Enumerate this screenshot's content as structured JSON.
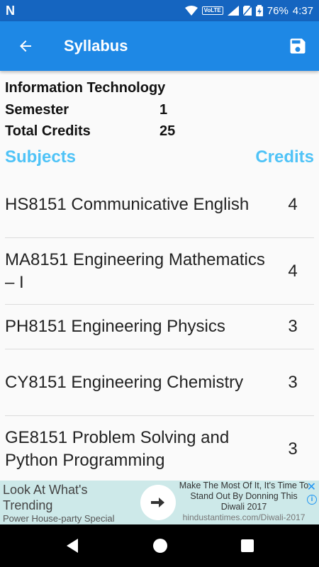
{
  "status_bar": {
    "left_icon": "N",
    "network_badge": "VoLTE",
    "battery_percent": "76%",
    "time": "4:37"
  },
  "app_bar": {
    "title": "Syllabus",
    "back_icon": "arrow-left-icon",
    "save_icon": "floppy-disk-icon"
  },
  "info": {
    "department": "Information Technology",
    "semester_label": "Semester",
    "semester_value": "1",
    "credits_label": "Total Credits",
    "credits_value": "25"
  },
  "table": {
    "subjects_header": "Subjects",
    "credits_header": "Credits",
    "rows": [
      {
        "subject": "HS8151 Communicative English",
        "credits": "4"
      },
      {
        "subject": "MA8151 Engineering Mathematics – I",
        "credits": "4"
      },
      {
        "subject": "PH8151 Engineering Physics",
        "credits": "3"
      },
      {
        "subject": "CY8151 Engineering Chemistry",
        "credits": "3"
      },
      {
        "subject": "GE8151 Problem Solving and Python Programming",
        "credits": "3"
      }
    ]
  },
  "ad": {
    "headline": "Look At What's Trending",
    "subline": "Power House-party Special",
    "body": "Make The Most Of It, It's Time To Stand Out By Donning This Diwali 2017",
    "url": "hindustantimes.com/Diwali-2017"
  },
  "colors": {
    "status_bar": "#1565c0",
    "app_bar": "#1e88e5",
    "header_accent": "#4fc3f7"
  }
}
